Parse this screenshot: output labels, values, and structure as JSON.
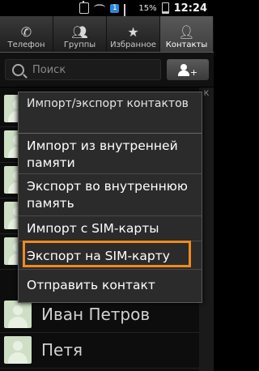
{
  "status_bar": {
    "battery_percent": "15%",
    "time": "12:24",
    "sim_badge": "1"
  },
  "tabs": [
    {
      "label": "Телефон",
      "icon": "phone-icon",
      "active": false
    },
    {
      "label": "Группы",
      "icon": "groups-icon",
      "active": false
    },
    {
      "label": "Избранное",
      "icon": "star-icon",
      "active": false
    },
    {
      "label": "Контакты",
      "icon": "contact-icon",
      "active": true
    }
  ],
  "search": {
    "placeholder": "Поиск"
  },
  "letter_index": [
    "",
    "К",
    "",
    "",
    "",
    "",
    "",
    "",
    "",
    "",
    "",
    "",
    "",
    "",
    "",
    "",
    "",
    "",
    "",
    ""
  ],
  "contacts": [
    {
      "name": ""
    },
    {
      "name": ""
    },
    {
      "name": ""
    },
    {
      "name": ""
    },
    {
      "name": ""
    },
    {
      "name": "Иван Петров"
    },
    {
      "name": "Петя"
    }
  ],
  "menu": {
    "title": "Импорт/экспорт контактов",
    "items": [
      {
        "label": "Импорт из внутренней памяти"
      },
      {
        "label": "Экспорт во внутреннюю память"
      },
      {
        "label": "Импорт с SIM-карты"
      },
      {
        "label": "Экспорт на SIM-карту",
        "highlighted": true
      },
      {
        "label": "Отправить контакт"
      }
    ]
  },
  "colors": {
    "highlight": "#f08a1d",
    "sim_badge": "#2e86d3"
  }
}
